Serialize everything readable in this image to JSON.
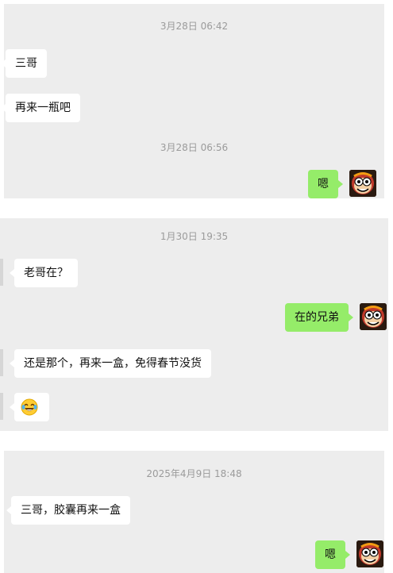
{
  "panel1": {
    "time1": "3月28日 06:42",
    "msg1": "三哥",
    "msg2": "再来一瓶吧",
    "time2": "3月28日 06:56",
    "reply1": "嗯"
  },
  "panel2": {
    "time": "1月30日 19:35",
    "msg1": "老哥在？",
    "reply1": "在的兄弟",
    "msg2": "还是那个，再来一盒，免得春节没货",
    "msg3_emoji": "laughing-tears-emoji"
  },
  "panel3": {
    "time": "2025年4月9日 18:48",
    "msg1": "三哥，胶囊再来一盒",
    "reply1": "嗯"
  },
  "colors": {
    "panel_bg": "#ededed",
    "sent_bubble": "#95ec69",
    "received_bubble": "#ffffff",
    "timestamp": "#9b9b9b"
  },
  "icons": {
    "avatar": "cartoon-monkey-avatar"
  }
}
